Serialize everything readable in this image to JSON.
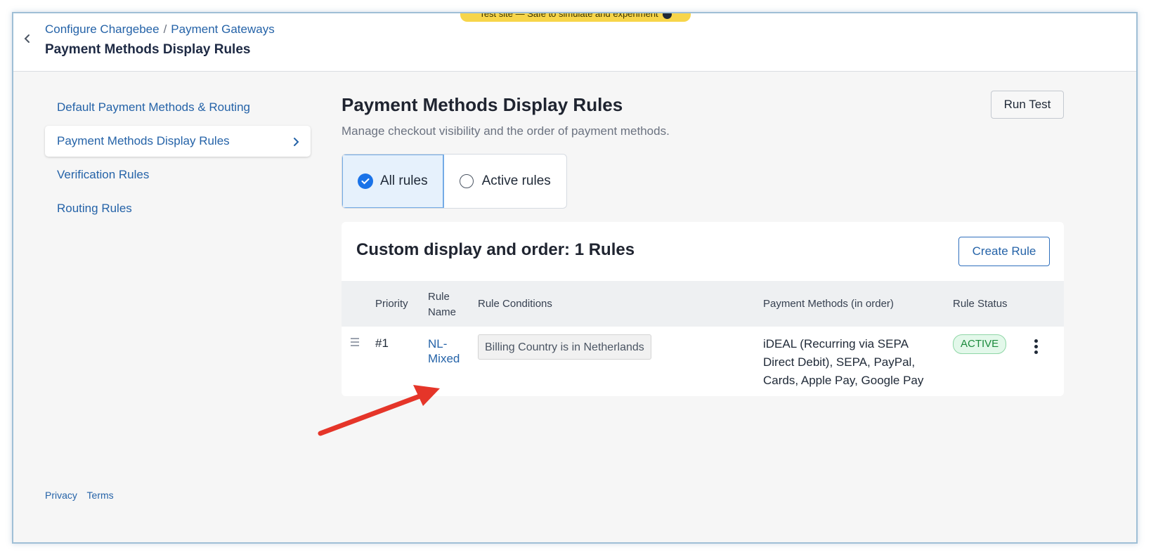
{
  "header": {
    "breadcrumb": [
      "Configure Chargebee",
      "Payment Gateways"
    ],
    "breadcrumb_sep": "/",
    "title": "Payment Methods Display Rules",
    "banner_text": "Test site — Safe to simulate and experiment"
  },
  "sidebar": {
    "items": [
      {
        "label": "Default Payment Methods & Routing",
        "active": false
      },
      {
        "label": "Payment Methods Display Rules",
        "active": true
      },
      {
        "label": "Verification Rules",
        "active": false
      },
      {
        "label": "Routing Rules",
        "active": false
      }
    ]
  },
  "footer": {
    "privacy": "Privacy",
    "terms": "Terms"
  },
  "main": {
    "title": "Payment Methods Display Rules",
    "description": "Manage checkout visibility and the order of payment methods.",
    "run_test_label": "Run Test",
    "filters": [
      {
        "label": "All rules",
        "selected": true
      },
      {
        "label": "Active rules",
        "selected": false
      }
    ],
    "card": {
      "title": "Custom display and order: 1 Rules",
      "create_rule_label": "Create Rule",
      "columns": {
        "priority": "Priority",
        "rule_name_line1": "Rule",
        "rule_name_line2": "Name",
        "conditions": "Rule Conditions",
        "methods": "Payment Methods (in order)",
        "status": "Rule Status"
      },
      "rows": [
        {
          "priority": "#1",
          "name_line1": "NL-",
          "name_line2": "Mixed",
          "condition": "Billing Country is in Netherlands",
          "methods_line1": "iDEAL (Recurring via SEPA",
          "methods_line2": "Direct Debit), SEPA, PayPal,",
          "methods_line3": "Cards, Apple Pay, Google Pay",
          "status": "ACTIVE"
        }
      ]
    }
  },
  "colors": {
    "link": "#2563a8",
    "accent": "#1a73e8",
    "status_active_bg": "#e3f8ea",
    "status_active_text": "#1b8a3c",
    "annotation_arrow": "#e53529"
  }
}
